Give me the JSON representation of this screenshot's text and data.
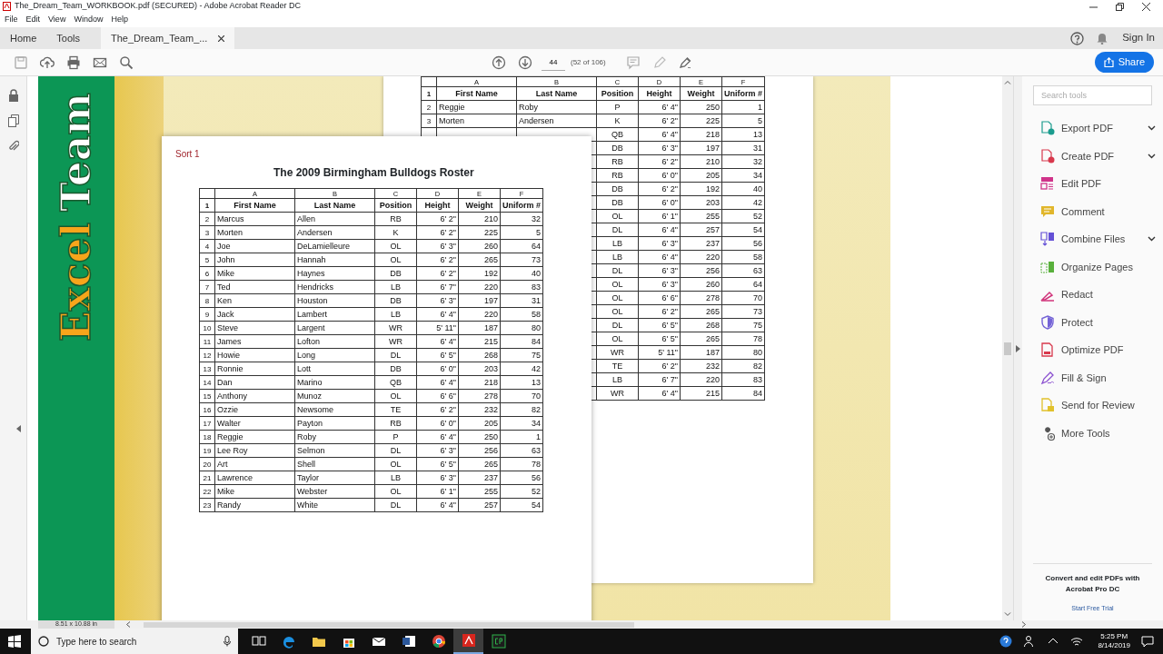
{
  "window": {
    "title": "The_Dream_Team_WORKBOOK.pdf (SECURED) - Adobe Acrobat Reader DC"
  },
  "menu": [
    "File",
    "Edit",
    "View",
    "Window",
    "Help"
  ],
  "nav_tabs": [
    {
      "label": "Home",
      "selected": false,
      "closable": false
    },
    {
      "label": "Tools",
      "selected": false,
      "closable": false
    },
    {
      "label": "The_Dream_Team_...",
      "selected": true,
      "closable": true
    }
  ],
  "sign_in": "Sign In",
  "toolbar": {
    "page": "44",
    "page_count": "(52 of 106)",
    "share": "Share"
  },
  "cover": {
    "words": [
      "Excel",
      "Team"
    ]
  },
  "back_sheet": {
    "columns": [
      "A",
      "B",
      "C",
      "D",
      "E",
      "F"
    ],
    "header": {
      "number": "1",
      "cells": [
        "First Name",
        "Last Name",
        "Position",
        "Height",
        "Weight",
        "Uniform #"
      ]
    },
    "rows": [
      {
        "number": "2",
        "cells": [
          "Reggie",
          "Roby",
          "P",
          "6' 4\"",
          "250",
          "1"
        ]
      },
      {
        "number": "3",
        "cells": [
          "Morten",
          "Andersen",
          "K",
          "6' 2\"",
          "225",
          "5"
        ]
      },
      {
        "cells": [
          "QB",
          "6' 4\"",
          "218",
          "13"
        ]
      },
      {
        "cells": [
          "DB",
          "6' 3\"",
          "197",
          "31"
        ]
      },
      {
        "cells": [
          "RB",
          "6' 2\"",
          "210",
          "32"
        ]
      },
      {
        "cells": [
          "RB",
          "6' 0\"",
          "205",
          "34"
        ]
      },
      {
        "cells": [
          "DB",
          "6' 2\"",
          "192",
          "40"
        ]
      },
      {
        "cells": [
          "DB",
          "6' 0\"",
          "203",
          "42"
        ]
      },
      {
        "cells": [
          "OL",
          "6' 1\"",
          "255",
          "52"
        ]
      },
      {
        "cells": [
          "DL",
          "6' 4\"",
          "257",
          "54"
        ]
      },
      {
        "cells": [
          "LB",
          "6' 3\"",
          "237",
          "56"
        ]
      },
      {
        "cells": [
          "LB",
          "6' 4\"",
          "220",
          "58"
        ]
      },
      {
        "cells": [
          "DL",
          "6' 3\"",
          "256",
          "63"
        ]
      },
      {
        "cells": [
          "OL",
          "6' 3\"",
          "260",
          "64"
        ]
      },
      {
        "cells": [
          "OL",
          "6' 6\"",
          "278",
          "70"
        ]
      },
      {
        "cells": [
          "OL",
          "6' 2\"",
          "265",
          "73"
        ]
      },
      {
        "cells": [
          "DL",
          "6' 5\"",
          "268",
          "75"
        ]
      },
      {
        "cells": [
          "OL",
          "6' 5\"",
          "265",
          "78"
        ]
      },
      {
        "cells": [
          "WR",
          "5' 11\"",
          "187",
          "80"
        ]
      },
      {
        "cells": [
          "TE",
          "6' 2\"",
          "232",
          "82"
        ]
      },
      {
        "cells": [
          "LB",
          "6' 7\"",
          "220",
          "83"
        ]
      },
      {
        "cells": [
          "WR",
          "6' 4\"",
          "215",
          "84"
        ]
      }
    ]
  },
  "popup": {
    "caption": "Sort 1",
    "title": "The 2009 Birmingham Bulldogs Roster",
    "columns": [
      "A",
      "B",
      "C",
      "D",
      "E",
      "F"
    ],
    "header": {
      "number": "1",
      "cells": [
        "First Name",
        "Last Name",
        "Position",
        "Height",
        "Weight",
        "Uniform #"
      ]
    },
    "rows": [
      {
        "number": "2",
        "cells": [
          "Marcus",
          "Allen",
          "RB",
          "6' 2\"",
          "210",
          "32"
        ]
      },
      {
        "number": "3",
        "cells": [
          "Morten",
          "Andersen",
          "K",
          "6' 2\"",
          "225",
          "5"
        ]
      },
      {
        "number": "4",
        "cells": [
          "Joe",
          "DeLamielleure",
          "OL",
          "6' 3\"",
          "260",
          "64"
        ]
      },
      {
        "number": "5",
        "cells": [
          "John",
          "Hannah",
          "OL",
          "6' 2\"",
          "265",
          "73"
        ]
      },
      {
        "number": "6",
        "cells": [
          "Mike",
          "Haynes",
          "DB",
          "6' 2\"",
          "192",
          "40"
        ]
      },
      {
        "number": "7",
        "cells": [
          "Ted",
          "Hendricks",
          "LB",
          "6' 7\"",
          "220",
          "83"
        ]
      },
      {
        "number": "8",
        "cells": [
          "Ken",
          "Houston",
          "DB",
          "6' 3\"",
          "197",
          "31"
        ]
      },
      {
        "number": "9",
        "cells": [
          "Jack",
          "Lambert",
          "LB",
          "6' 4\"",
          "220",
          "58"
        ]
      },
      {
        "number": "10",
        "cells": [
          "Steve",
          "Largent",
          "WR",
          "5' 11\"",
          "187",
          "80"
        ]
      },
      {
        "number": "11",
        "cells": [
          "James",
          "Lofton",
          "WR",
          "6' 4\"",
          "215",
          "84"
        ]
      },
      {
        "number": "12",
        "cells": [
          "Howie",
          "Long",
          "DL",
          "6' 5\"",
          "268",
          "75"
        ]
      },
      {
        "number": "13",
        "cells": [
          "Ronnie",
          "Lott",
          "DB",
          "6' 0\"",
          "203",
          "42"
        ]
      },
      {
        "number": "14",
        "cells": [
          "Dan",
          "Marino",
          "QB",
          "6' 4\"",
          "218",
          "13"
        ]
      },
      {
        "number": "15",
        "cells": [
          "Anthony",
          "Munoz",
          "OL",
          "6' 6\"",
          "278",
          "70"
        ]
      },
      {
        "number": "16",
        "cells": [
          "Ozzie",
          "Newsome",
          "TE",
          "6' 2\"",
          "232",
          "82"
        ]
      },
      {
        "number": "17",
        "cells": [
          "Walter",
          "Payton",
          "RB",
          "6' 0\"",
          "205",
          "34"
        ]
      },
      {
        "number": "18",
        "cells": [
          "Reggie",
          "Roby",
          "P",
          "6' 4\"",
          "250",
          "1"
        ]
      },
      {
        "number": "19",
        "cells": [
          "Lee Roy",
          "Selmon",
          "DL",
          "6' 3\"",
          "256",
          "63"
        ]
      },
      {
        "number": "20",
        "cells": [
          "Art",
          "Shell",
          "OL",
          "6' 5\"",
          "265",
          "78"
        ]
      },
      {
        "number": "21",
        "cells": [
          "Lawrence",
          "Taylor",
          "LB",
          "6' 3\"",
          "237",
          "56"
        ]
      },
      {
        "number": "22",
        "cells": [
          "Mike",
          "Webster",
          "OL",
          "6' 1\"",
          "255",
          "52"
        ]
      },
      {
        "number": "23",
        "cells": [
          "Randy",
          "White",
          "DL",
          "6' 4\"",
          "257",
          "54"
        ]
      }
    ]
  },
  "tools_panel": {
    "search": {
      "placeholder": "Search tools"
    },
    "tools": [
      {
        "kind": "export",
        "label": "Export PDF",
        "expandable": true,
        "color": "#1b9c8e"
      },
      {
        "kind": "create",
        "label": "Create PDF",
        "expandable": true,
        "color": "#d8384c"
      },
      {
        "kind": "edit",
        "label": "Edit PDF",
        "expandable": false,
        "color": "#d0338a"
      },
      {
        "kind": "comment",
        "label": "Comment",
        "expandable": false,
        "color": "#e1b62b"
      },
      {
        "kind": "combine",
        "label": "Combine Files",
        "expandable": true,
        "color": "#6450d6"
      },
      {
        "kind": "organize",
        "label": "Organize Pages",
        "expandable": false,
        "color": "#59b03c"
      },
      {
        "kind": "redact",
        "label": "Redact",
        "expandable": false,
        "color": "#d0337a"
      },
      {
        "kind": "protect",
        "label": "Protect",
        "expandable": false,
        "color": "#7463d6"
      },
      {
        "kind": "optimize",
        "label": "Optimize PDF",
        "expandable": false,
        "color": "#d8384c"
      },
      {
        "kind": "sign",
        "label": "Fill & Sign",
        "expandable": false,
        "color": "#8a4fd0"
      },
      {
        "kind": "review",
        "label": "Send for Review",
        "expandable": false,
        "color": "#e1c12b"
      },
      {
        "kind": "more",
        "label": "More Tools",
        "expandable": false,
        "color": "#555555"
      }
    ],
    "promo": "Convert and edit PDFs with Acrobat Pro DC",
    "trial": "Start Free Trial"
  },
  "status_bar": {
    "page_size": "8.51 x 10.88 in"
  },
  "taskbar": {
    "search": {
      "placeholder": "Type here to search"
    },
    "apps": [
      {
        "kind": "taskview",
        "selected": false
      },
      {
        "kind": "edge",
        "selected": false
      },
      {
        "kind": "explorer",
        "selected": false
      },
      {
        "kind": "store",
        "selected": false
      },
      {
        "kind": "mail",
        "selected": false
      },
      {
        "kind": "word",
        "selected": false
      },
      {
        "kind": "chrome",
        "selected": false
      },
      {
        "kind": "acrobat",
        "selected": true
      },
      {
        "kind": "camtasia",
        "selected": false
      }
    ],
    "time": "5:25 PM",
    "date": "8/14/2019"
  }
}
